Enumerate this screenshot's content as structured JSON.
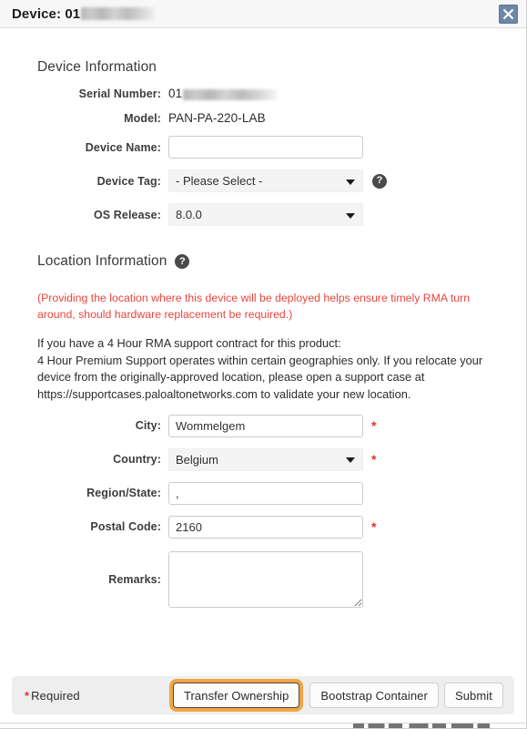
{
  "window": {
    "title_prefix": "Device: 01",
    "title_redacted": true,
    "close_icon": "close-icon"
  },
  "device_info": {
    "section_title": "Device Information",
    "fields": {
      "serial_number_label": "Serial Number:",
      "serial_number_value": "01",
      "serial_number_redacted": true,
      "model_label": "Model:",
      "model_value": "PAN-PA-220-LAB",
      "device_name_label": "Device Name:",
      "device_name_value": "",
      "device_name_placeholder": "",
      "device_tag_label": "Device Tag:",
      "device_tag_value": "- Please Select -",
      "device_tag_help_icon": "help-icon",
      "os_release_label": "OS Release:",
      "os_release_value": "8.0.0"
    }
  },
  "location_info": {
    "section_title": "Location Information",
    "section_help_icon": "help-icon",
    "warning_text": "(Providing the location where this device will be deployed helps ensure timely RMA turn around, should hardware replacement be required.)",
    "info_line_1": "If you have a 4 Hour RMA support contract for this product:",
    "info_line_2": "4 Hour Premium Support operates within certain geographies only. If you relocate your device from the originally-approved location, please open a support case at https://supportcases.paloaltonetworks.com to validate your new location.",
    "fields": {
      "city_label": "City:",
      "city_value": "Wommelgem",
      "city_required": true,
      "country_label": "Country:",
      "country_value": "Belgium",
      "country_required": true,
      "region_state_label": "Region/State:",
      "region_state_value": ",",
      "region_state_required": false,
      "postal_code_label": "Postal Code:",
      "postal_code_value": "2160",
      "postal_code_required": true,
      "remarks_label": "Remarks:",
      "remarks_value": ""
    }
  },
  "footer": {
    "required_star": "*",
    "required_label": "Required",
    "transfer_ownership_label": "Transfer Ownership",
    "bootstrap_container_label": "Bootstrap Container",
    "submit_label": "Submit"
  },
  "colors": {
    "required_red": "#e03131",
    "warning_red": "#e8453c",
    "highlight_orange": "#f2a444",
    "close_button_blue": "#6e87a8",
    "footer_gray": "#eeeeee",
    "select_gray": "#f4f4f4"
  }
}
